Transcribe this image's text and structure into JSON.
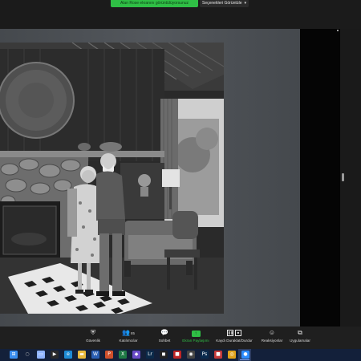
{
  "share_bar": {
    "notice": "Alan Rose ekranını görüntülüyorsunuz",
    "view_options": "Seçenekleri Görüntüle",
    "view_options_icon": "chevron-down-icon"
  },
  "controls": {
    "security": "Güvenlik",
    "participants": "Katılımcılar",
    "participants_count": "85",
    "chat": "Sohbet",
    "share_screen": "Ekran Paylaşımı",
    "record": "Kaydı Duraklat/Durdur",
    "reactions": "Reaksiyonlar",
    "apps": "Uygulamalar",
    "accent": "#2fbf45"
  },
  "taskbar": {
    "apps": [
      {
        "name": "start",
        "glyph": "⊞",
        "color": "#3a8ef0"
      },
      {
        "name": "search",
        "glyph": "○",
        "color": "#c0c0c0"
      },
      {
        "name": "task-view",
        "glyph": "▭",
        "color": "#8fb4ff"
      },
      {
        "name": "app-dark",
        "glyph": "▶",
        "color": "#2a2a2a"
      },
      {
        "name": "edge",
        "glyph": "e",
        "color": "#1e8bd6"
      },
      {
        "name": "explorer",
        "glyph": "▬",
        "color": "#e9b93b"
      },
      {
        "name": "word",
        "glyph": "W",
        "color": "#2b5fb4"
      },
      {
        "name": "powerpoint",
        "glyph": "P",
        "color": "#d0502b"
      },
      {
        "name": "excel",
        "glyph": "X",
        "color": "#1f7a45"
      },
      {
        "name": "photos",
        "glyph": "◆",
        "color": "#6a4cc9"
      },
      {
        "name": "lightroom",
        "glyph": "Lr",
        "color": "#0b2a4a"
      },
      {
        "name": "dark-app",
        "glyph": "◼",
        "color": "#222"
      },
      {
        "name": "photoshop-red",
        "glyph": "■",
        "color": "#c02626"
      },
      {
        "name": "obs",
        "glyph": "◉",
        "color": "#444"
      },
      {
        "name": "photoshop",
        "glyph": "Ps",
        "color": "#0a2a4d"
      },
      {
        "name": "app-red",
        "glyph": "■",
        "color": "#c43a3a"
      },
      {
        "name": "chrome",
        "glyph": "◎",
        "color": "#e0a21a"
      },
      {
        "name": "zoom",
        "glyph": "●",
        "color": "#2d8cff"
      }
    ]
  }
}
